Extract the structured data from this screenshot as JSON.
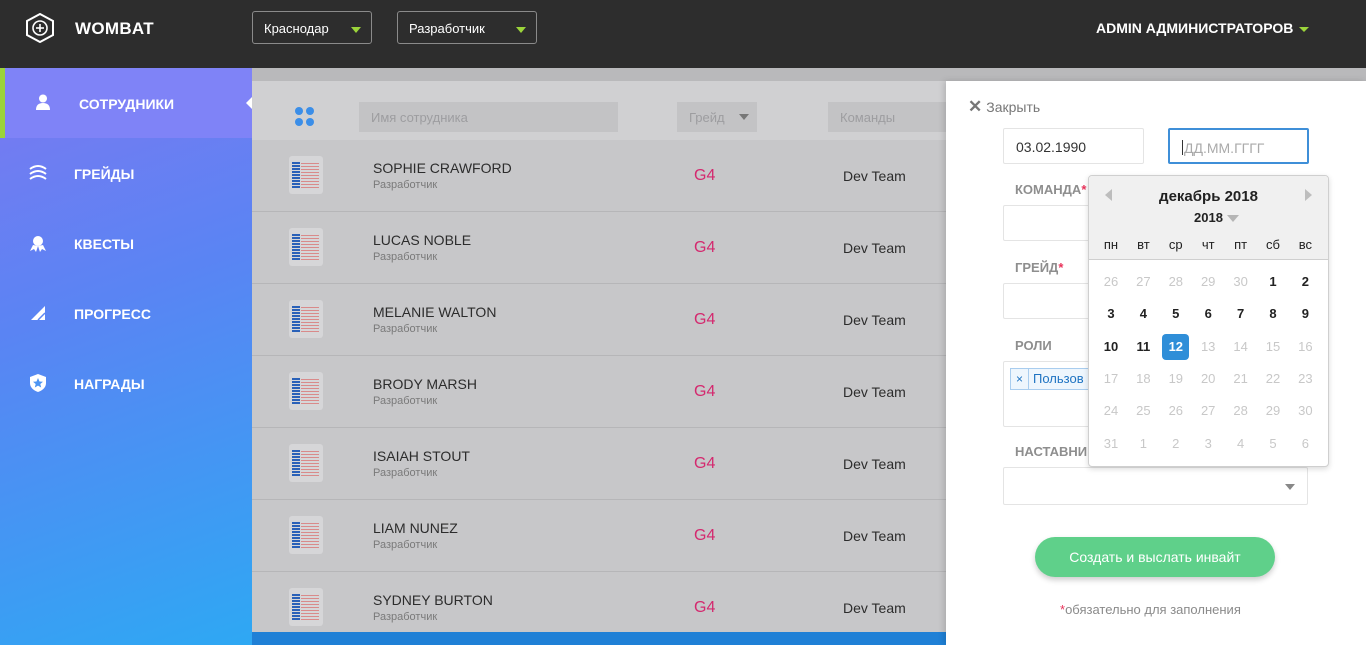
{
  "app": {
    "title": "WOMBAT"
  },
  "header": {
    "city": "Краснодар",
    "role": "Разработчик",
    "user": "ADMIN АДМИНИСТРАТОРОВ"
  },
  "sidebar": {
    "items": [
      {
        "label": "СОТРУДНИКИ",
        "icon": "person-icon",
        "active": true
      },
      {
        "label": "ГРЕЙДЫ",
        "icon": "layers-icon"
      },
      {
        "label": "КВЕСТЫ",
        "icon": "award-icon"
      },
      {
        "label": "ПРОГРЕСС",
        "icon": "signal-icon"
      },
      {
        "label": "НАГРАДЫ",
        "icon": "badge-star-icon"
      }
    ]
  },
  "filters": {
    "name_placeholder": "Имя сотрудника",
    "grade_placeholder": "Грейд",
    "teams_placeholder": "Команды"
  },
  "employees": [
    {
      "name": "SOPHIE CRAWFORD",
      "role": "Разработчик",
      "grade": "G4",
      "team": "Dev Team"
    },
    {
      "name": "LUCAS NOBLE",
      "role": "Разработчик",
      "grade": "G4",
      "team": "Dev Team"
    },
    {
      "name": "MELANIE WALTON",
      "role": "Разработчик",
      "grade": "G4",
      "team": "Dev Team"
    },
    {
      "name": "BRODY MARSH",
      "role": "Разработчик",
      "grade": "G4",
      "team": "Dev Team"
    },
    {
      "name": "ISAIAH STOUT",
      "role": "Разработчик",
      "grade": "G4",
      "team": "Dev Team"
    },
    {
      "name": "LIAM NUNEZ",
      "role": "Разработчик",
      "grade": "G4",
      "team": "Dev Team"
    },
    {
      "name": "SYDNEY BURTON",
      "role": "Разработчик",
      "grade": "G4",
      "team": "Dev Team"
    }
  ],
  "panel": {
    "close_label": "Закрыть",
    "birth_date_value": "03.02.1990",
    "date_placeholder": "ДД.ММ.ГГГГ",
    "team_label": "КОМАНДА",
    "grade_label": "ГРЕЙД",
    "roles_label": "РОЛИ",
    "role_tag": "Пользов",
    "role_tag_remove": "×",
    "mentor_label": "НАСТАВНИК",
    "required_mark": "*",
    "submit_label": "Создать и выслать инвайт",
    "required_note": "обязательно для заполнения"
  },
  "datepicker": {
    "month_label": "декабрь 2018",
    "year": "2018",
    "weekdays": [
      "пн",
      "вт",
      "ср",
      "чт",
      "пт",
      "сб",
      "вс"
    ],
    "weeks": [
      [
        "26",
        "27",
        "28",
        "29",
        "30",
        "1",
        "2"
      ],
      [
        "3",
        "4",
        "5",
        "6",
        "7",
        "8",
        "9"
      ],
      [
        "10",
        "11",
        "12",
        "13",
        "14",
        "15",
        "16"
      ],
      [
        "17",
        "18",
        "19",
        "20",
        "21",
        "22",
        "23"
      ],
      [
        "24",
        "25",
        "26",
        "27",
        "28",
        "29",
        "30"
      ],
      [
        "31",
        "1",
        "2",
        "3",
        "4",
        "5",
        "6"
      ]
    ],
    "selected_day": "12"
  },
  "colors": {
    "accent_green": "#9bd43a",
    "grade_pink": "#d4286e",
    "selected_blue": "#2f8ed8",
    "submit_green": "#5fd08a"
  }
}
